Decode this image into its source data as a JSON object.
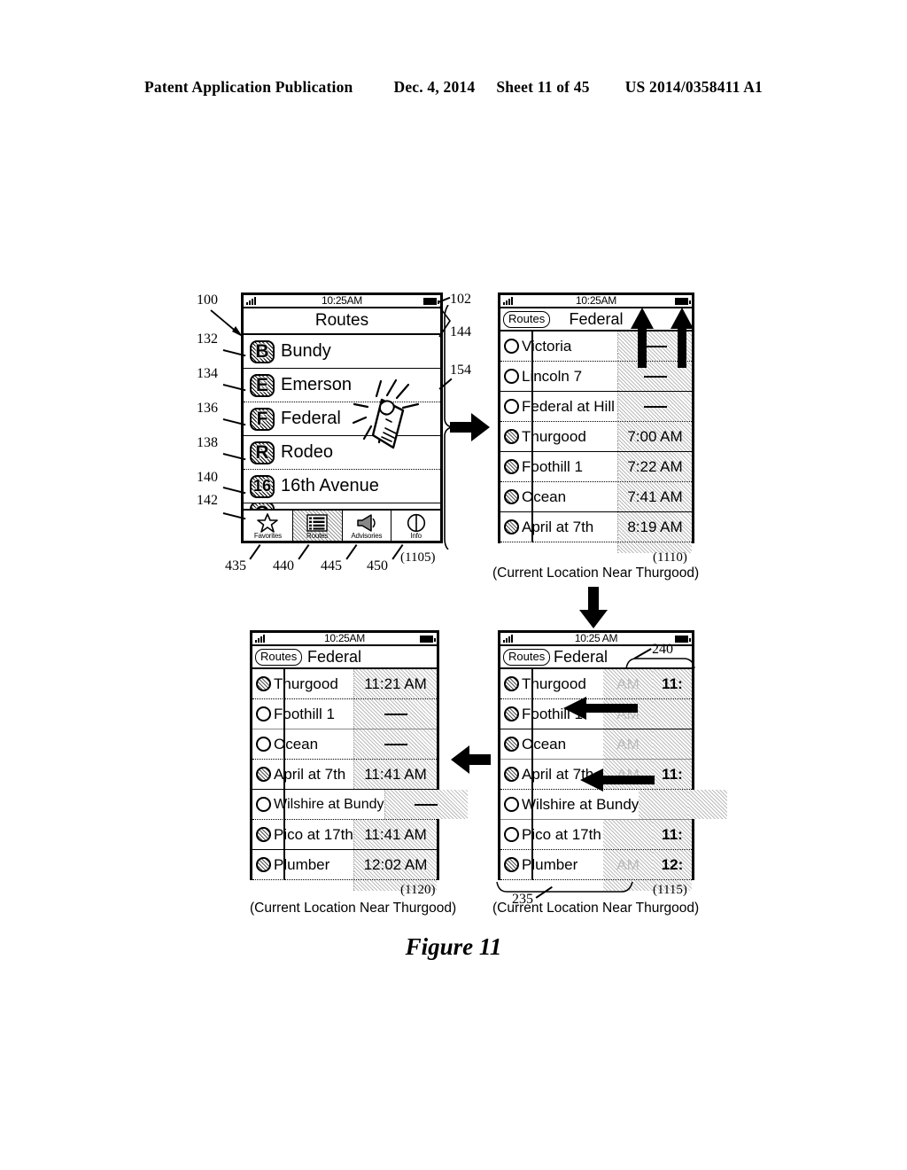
{
  "header": {
    "title": "Patent Application Publication",
    "date": "Dec. 4, 2014",
    "sheet": "Sheet 11 of 45",
    "patent_number": "US 2014/0358411 A1"
  },
  "figure": {
    "caption": "Figure 11"
  },
  "screen_routes": {
    "ref_device": "100",
    "ref_statusbar": "102",
    "ref_titlebar": "144",
    "ref_list": "154",
    "id_label": "(1105)",
    "statusbar": {
      "time": "10:25AM",
      "signal_icon": "signal-bars-icon",
      "battery_icon": "battery-icon"
    },
    "title": "Routes",
    "rows": [
      {
        "ref": "132",
        "badge": "B",
        "label": "Bundy"
      },
      {
        "ref": "134",
        "badge": "E",
        "label": "Emerson"
      },
      {
        "ref": "136",
        "badge": "F",
        "label": "Federal"
      },
      {
        "ref": "138",
        "badge": "R",
        "label": "Rodeo"
      },
      {
        "ref": "140",
        "badge": "16",
        "label": "16th Avenue"
      },
      {
        "ref": "142",
        "badge": "O",
        "label": ""
      }
    ],
    "tabs": [
      {
        "ref": "435",
        "label": "Favorites",
        "icon": "star-icon",
        "active": false
      },
      {
        "ref": "440",
        "label": "Routes",
        "icon": "list-icon",
        "active": true
      },
      {
        "ref": "445",
        "label": "Advisories",
        "icon": "megaphone-icon",
        "active": false
      },
      {
        "ref": "450",
        "label": "Info",
        "icon": "info-icon",
        "active": false
      }
    ],
    "gesture_icon": "finger-tap-icon"
  },
  "screen_schedule_am": {
    "id_label": "(1110)",
    "caption": "(Current Location Near Thurgood)",
    "statusbar": {
      "time": "10:25AM"
    },
    "back_button": "Routes",
    "title": "Federal",
    "rows": [
      {
        "stop": "Victoria",
        "time": "—",
        "visited": false
      },
      {
        "stop": "Lincoln 7",
        "time": "—",
        "visited": false
      },
      {
        "stop": "Federal at Hill",
        "time": "—",
        "visited": false
      },
      {
        "stop": "Thurgood",
        "time": "7:00 AM",
        "visited": true
      },
      {
        "stop": "Foothill 1",
        "time": "7:22 AM",
        "visited": true
      },
      {
        "stop": "Ocean",
        "time": "7:41 AM",
        "visited": true
      },
      {
        "stop": "April at 7th",
        "time": "8:19 AM",
        "visited": true
      }
    ],
    "overlay_arrows": "two-up-arrows"
  },
  "screen_schedule_scrolled": {
    "id_label": "(1115)",
    "caption": "(Current Location Near Thurgood)",
    "ref_timecolumn": "240",
    "ref_list": "235",
    "statusbar": {
      "time": "10:25 AM"
    },
    "back_button": "Routes",
    "title": "Federal",
    "rows": [
      {
        "stop": "Thurgood",
        "time_ghost": "AM",
        "time": "11:",
        "visited": true
      },
      {
        "stop": "Foothill 1",
        "time_ghost": "AM",
        "time": "",
        "visited": true
      },
      {
        "stop": "Ocean",
        "time_ghost": "AM",
        "time": "",
        "visited": true
      },
      {
        "stop": "April at 7th",
        "time_ghost": "AM",
        "time": "11:",
        "visited": true
      },
      {
        "stop": "Wilshire at Bundy",
        "time_ghost": "",
        "time": "",
        "visited": false
      },
      {
        "stop": "Pico at 17th",
        "time_ghost": "",
        "time": "11:",
        "visited": false
      },
      {
        "stop": "Plumber",
        "time_ghost": "AM",
        "time": "12:",
        "visited": true
      }
    ],
    "overlay_arrows": "two-left-arrows"
  },
  "screen_schedule_pm": {
    "id_label": "(1120)",
    "caption": "(Current Location Near Thurgood)",
    "statusbar": {
      "time": "10:25AM"
    },
    "back_button": "Routes",
    "title": "Federal",
    "rows": [
      {
        "stop": "Thurgood",
        "time": "11:21 AM",
        "visited": true
      },
      {
        "stop": "Foothill 1",
        "time": "—",
        "visited": false
      },
      {
        "stop": "Ocean",
        "time": "—",
        "visited": false
      },
      {
        "stop": "April at 7th",
        "time": "11:41 AM",
        "visited": true
      },
      {
        "stop": "Wilshire at Bundy",
        "time": "—",
        "visited": false
      },
      {
        "stop": "Pico at 17th",
        "time": "11:41 AM",
        "visited": true
      },
      {
        "stop": "Plumber",
        "time": "12:02 AM",
        "visited": true
      }
    ]
  },
  "flow_arrows": {
    "routes_to_schedule": "right-arrow",
    "schedule_to_scrolled": "down-arrow",
    "scrolled_to_pm": "left-arrow"
  }
}
